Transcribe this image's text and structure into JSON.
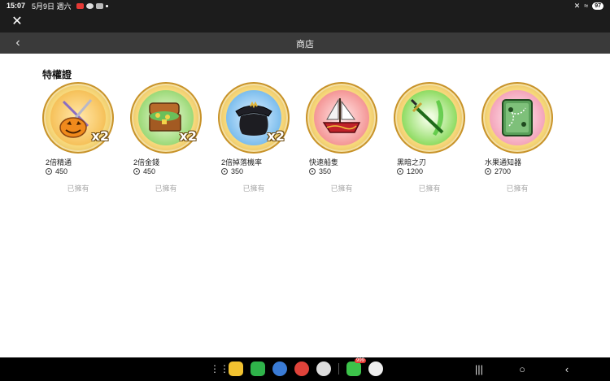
{
  "status": {
    "time": "15:07",
    "date": "5月9日 週六",
    "battery": "97"
  },
  "header": {
    "title": "商店"
  },
  "section": {
    "title": "特權證"
  },
  "items": [
    {
      "name": "2倍精通",
      "price": "450",
      "status": "已擁有",
      "multiplier": "x2",
      "icon": "pumpkin-swords-icon",
      "glow": "#f2a22b"
    },
    {
      "name": "2倍金錢",
      "price": "450",
      "status": "已擁有",
      "multiplier": "x2",
      "icon": "treasure-chest-icon",
      "glow": "#4fbf3a"
    },
    {
      "name": "2倍掉落機率",
      "price": "350",
      "status": "已擁有",
      "multiplier": "x2",
      "icon": "pirate-hat-icon",
      "glow": "#3a8fd6"
    },
    {
      "name": "快速船隻",
      "price": "350",
      "status": "已擁有",
      "multiplier": "",
      "icon": "ship-icon",
      "glow": "#e0434a"
    },
    {
      "name": "黑暗之刃",
      "price": "1200",
      "status": "已擁有",
      "multiplier": "",
      "icon": "dark-blade-icon",
      "glow": "#5cc93a"
    },
    {
      "name": "水果通知器",
      "price": "2700",
      "status": "已擁有",
      "multiplier": "",
      "icon": "fruit-notifier-icon",
      "glow": "#e25a7a"
    }
  ],
  "navbar": {
    "badge": "999"
  }
}
